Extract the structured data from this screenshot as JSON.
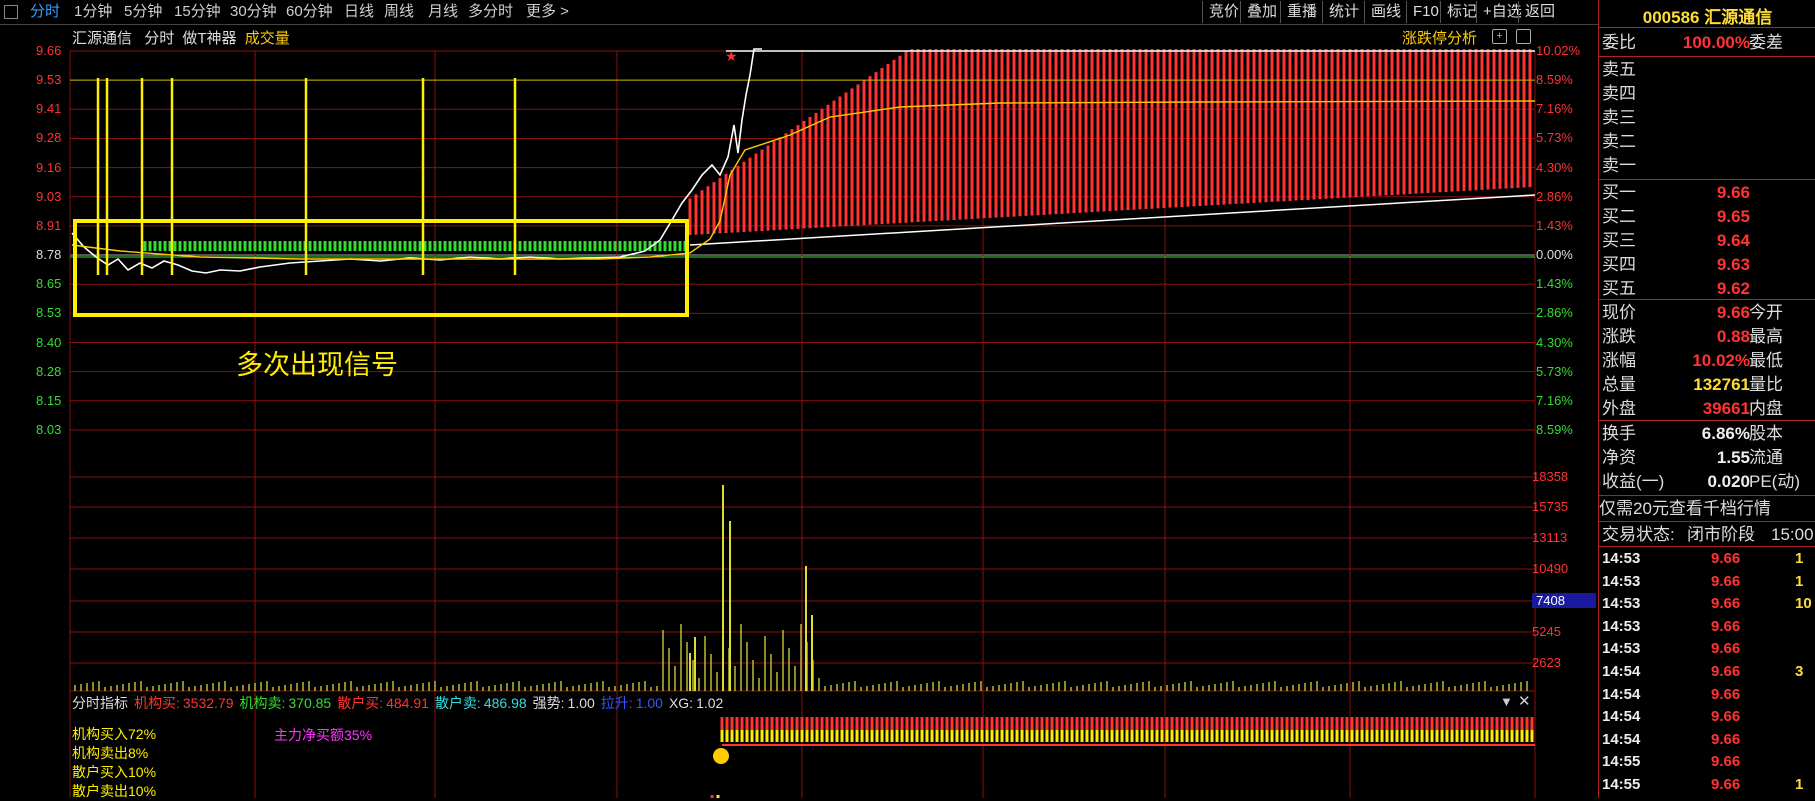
{
  "toolbar": {
    "left_items": [
      "分时",
      "1分钟",
      "5分钟",
      "15分钟",
      "30分钟",
      "60分钟",
      "日线",
      "周线",
      "月线",
      "多分时",
      "更多 >"
    ],
    "right_items": [
      "竞价",
      "叠加",
      "重播",
      "统计",
      "画线",
      "F10",
      "标记",
      "+自选",
      "返回"
    ]
  },
  "chart_header": {
    "stock_name": "汇源通信",
    "mode": "分时",
    "indicator": "做T神器",
    "volume_label": "成交量",
    "limit_analysis": "涨跌停分析"
  },
  "price_axis_left": [
    "9.66",
    "9.53",
    "9.41",
    "9.28",
    "9.16",
    "9.03",
    "8.91",
    "8.78",
    "8.65",
    "8.53",
    "8.40",
    "8.28",
    "8.15",
    "8.03"
  ],
  "pct_axis_right": [
    "10.02%",
    "8.59%",
    "7.16%",
    "5.73%",
    "4.30%",
    "2.86%",
    "1.43%",
    "0.00%",
    "1.43%",
    "2.86%",
    "4.30%",
    "5.73%",
    "7.16%",
    "8.59%"
  ],
  "volume_axis_right": [
    "18358",
    "15735",
    "13113",
    "10490",
    "7408",
    "5245",
    "2623"
  ],
  "volume_highlight": "7408",
  "annotation": "多次出现信号",
  "indicator_bar": {
    "title": "分时指标",
    "items": [
      {
        "label": "机构买:",
        "value": "3532.79"
      },
      {
        "label": "机构卖:",
        "value": "370.85"
      },
      {
        "label": "散户买:",
        "value": "484.91"
      },
      {
        "label": "散户卖:",
        "value": "486.98"
      },
      {
        "label": "强势:",
        "value": "1.00"
      },
      {
        "label": "拉升:",
        "value": "1.00"
      },
      {
        "label": "XG:",
        "value": "1.02"
      }
    ]
  },
  "indicator_text": {
    "inst_buy": "机构买入72%",
    "inst_sell": "机构卖出8%",
    "retail_buy": "散户买入10%",
    "retail_sell": "散户卖出10%",
    "main_net": "主力净买额35%"
  },
  "panel": {
    "code": "000586",
    "name": "汇源通信",
    "weibi_label": "委比",
    "weibi_value": "100.00%",
    "weicha_label": "委差",
    "sell_labels": [
      "卖五",
      "卖四",
      "卖三",
      "卖二",
      "卖一"
    ],
    "buy_levels": [
      {
        "label": "买一",
        "price": "9.66"
      },
      {
        "label": "买二",
        "price": "9.65"
      },
      {
        "label": "买三",
        "price": "9.64"
      },
      {
        "label": "买四",
        "price": "9.63"
      },
      {
        "label": "买五",
        "price": "9.62"
      }
    ],
    "quote": [
      {
        "label": "现价",
        "value": "9.66",
        "label2": "今开",
        "color": "r"
      },
      {
        "label": "涨跌",
        "value": "0.88",
        "label2": "最高",
        "color": "r"
      },
      {
        "label": "涨幅",
        "value": "10.02%",
        "label2": "最低",
        "color": "r"
      },
      {
        "label": "总量",
        "value": "132761",
        "label2": "量比",
        "color": "y"
      },
      {
        "label": "外盘",
        "value": "39661",
        "label2": "内盘",
        "color": "r"
      }
    ],
    "stats": [
      {
        "label": "换手",
        "value": "6.86%",
        "label2": "股本"
      },
      {
        "label": "净资",
        "value": "1.55",
        "label2": "流通"
      },
      {
        "label": "收益(一)",
        "value": "0.020",
        "label2": "PE(动)"
      }
    ],
    "promo": "仅需20元查看千档行情",
    "status_label": "交易状态:",
    "status_value": "闭市阶段",
    "status_time": "15:00",
    "ticks": [
      {
        "time": "14:53",
        "price": "9.66",
        "vol": "1"
      },
      {
        "time": "14:53",
        "price": "9.66",
        "vol": "1"
      },
      {
        "time": "14:53",
        "price": "9.66",
        "vol": "10"
      },
      {
        "time": "14:53",
        "price": "9.66",
        "vol": ""
      },
      {
        "time": "14:53",
        "price": "9.66",
        "vol": ""
      },
      {
        "time": "14:54",
        "price": "9.66",
        "vol": "3"
      },
      {
        "time": "14:54",
        "price": "9.66",
        "vol": ""
      },
      {
        "time": "14:54",
        "price": "9.66",
        "vol": ""
      },
      {
        "time": "14:54",
        "price": "9.66",
        "vol": ""
      },
      {
        "time": "14:55",
        "price": "9.66",
        "vol": ""
      },
      {
        "time": "14:55",
        "price": "9.66",
        "vol": "1"
      }
    ]
  },
  "colors": {
    "up": "#ff3333",
    "down": "#33dd33",
    "signal": "#ffee00",
    "price_line": "#ffffff",
    "avg_line": "#ffcc00",
    "grid": "#881111"
  }
}
